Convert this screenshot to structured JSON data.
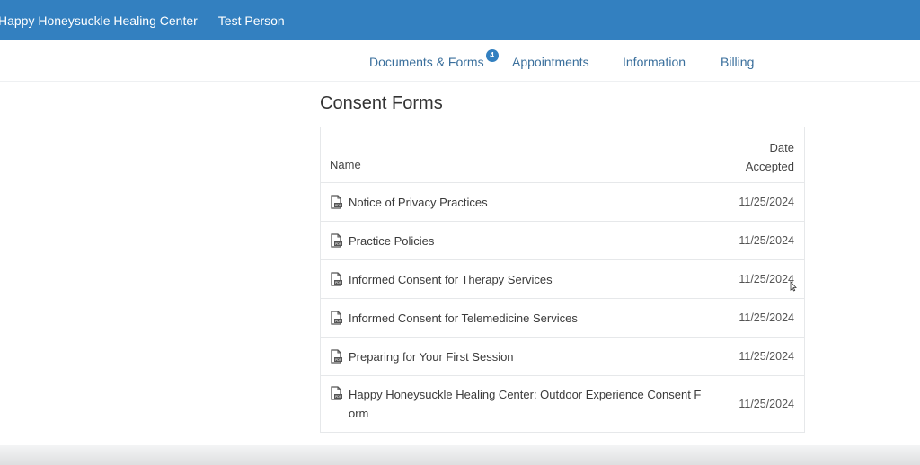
{
  "header": {
    "practice_name": "Happy Honeysuckle Healing Center",
    "user_name": "Test Person",
    "bg_color": "#3380c0"
  },
  "nav": {
    "items": [
      {
        "label": "Documents & Forms",
        "badge": "4"
      },
      {
        "label": "Appointments"
      },
      {
        "label": "Information"
      },
      {
        "label": "Billing"
      }
    ]
  },
  "section": {
    "title": "Consent Forms"
  },
  "table": {
    "columns": {
      "name": "Name",
      "date_line1": "Date",
      "date_line2": "Accepted"
    },
    "rows": [
      {
        "icon": "pdf-file-icon",
        "name": "Notice of Privacy Practices",
        "date": "11/25/2024"
      },
      {
        "icon": "pdf-file-icon",
        "name": "Practice Policies",
        "date": "11/25/2024"
      },
      {
        "icon": "pdf-file-icon",
        "name": "Informed Consent for Therapy Services",
        "date": "11/25/2024"
      },
      {
        "icon": "pdf-file-icon",
        "name": "Informed Consent for Telemedicine Services",
        "date": "11/25/2024"
      },
      {
        "icon": "pdf-file-icon",
        "name": "Preparing for Your First Session",
        "date": "11/25/2024"
      },
      {
        "icon": "pdf-file-icon",
        "name": "Happy Honeysuckle Healing Center: Outdoor Experience Consent Form",
        "date": "11/25/2024"
      }
    ]
  }
}
